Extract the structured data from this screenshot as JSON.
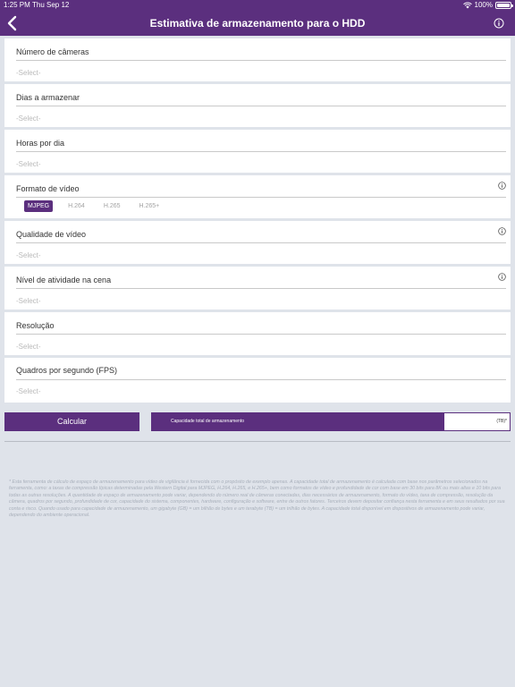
{
  "status_bar": {
    "time": "1:25 PM",
    "date": "Thu Sep 12",
    "battery": "100%"
  },
  "nav": {
    "title": "Estimativa de armazenamento para o HDD",
    "back_icon": "chevron-left-icon",
    "info_icon": "info-icon"
  },
  "fields": [
    {
      "label": "Número de câmeras",
      "value": "-Select-"
    },
    {
      "label": "Dias a armazenar",
      "value": "-Select-"
    },
    {
      "label": "Horas por dia",
      "value": "-Select-"
    },
    {
      "label": "Qualidade de vídeo",
      "value": "-Select-"
    },
    {
      "label": "Nível de atividade na cena",
      "value": "-Select-"
    },
    {
      "label": "Resolução",
      "value": "-Select-"
    },
    {
      "label": "Quadros por segundo (FPS)",
      "value": "-Select-"
    }
  ],
  "video_format": {
    "label": "Formato de vídeo",
    "options": [
      "MJPEG",
      "H.264",
      "H.265",
      "H.265+"
    ],
    "selected": "MJPEG"
  },
  "actions": {
    "calculate": "Calcular"
  },
  "capacity": {
    "label": "Capacidade total de armazenamento",
    "value": "",
    "unit": "(TB)*"
  },
  "disclaimer": "* Esta ferramenta de cálculo de espaço de armazenamento para vídeo de vigilância é fornecida com o propósito de exemplo apenas. A capacidade total de armazenamento é calculada com base nos parâmetros selecionados na ferramenta, como: a taxas de compressão típicas determinadas pela Western Digital para MJPEG, H.264, H.265, e H.265+, bem como formatos de vídeo e profundidade de cor com base em 30 bits para 8K ou mais altas e 10 bits para todas as outras resoluções. A quantidade de espaço de armazenamento pode variar, dependendo do número real de câmeras conectadas, dias necessários de armazenamento, formato do vídeo, taxa de compressão, resolução da câmera, quadros por segundo, profundidade de cor, capacidade do sistema, componentes, hardware, configuração e software, entre de outros fatores. Terceiros devem depositar confiança nesta ferramenta e em seus resultados por sua conta e risco. Quando usado para capacidade de armazenamento, um gigabyte (GB) = um bilhão de bytes e um terabyte (TB) = um trilhão de bytes. A capacidade total disponível em dispositivos de armazenamento pode variar, dependendo do ambiente operacional."
}
